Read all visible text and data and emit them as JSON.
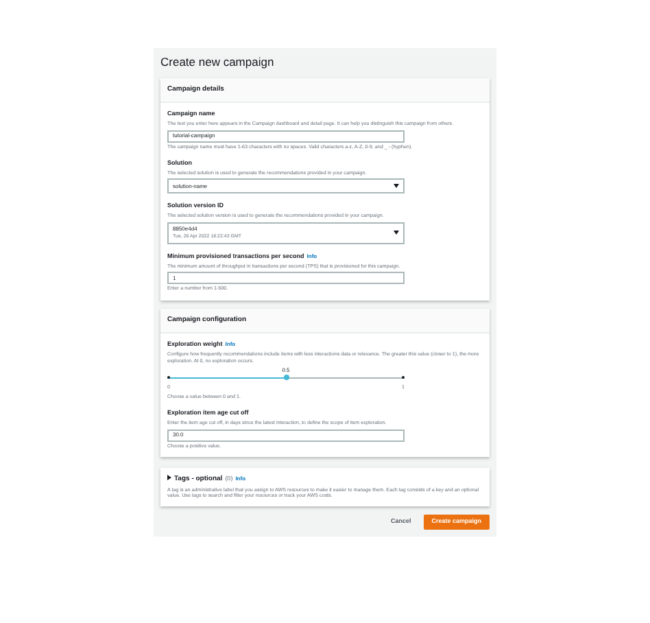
{
  "title": "Create new campaign",
  "details": {
    "heading": "Campaign details",
    "fields": [
      {
        "kind": "input",
        "label": "Campaign name",
        "description": "The text you enter here appears in the Campaign dashboard and detail page. It can help you distinguish this campaign from others.",
        "value": "tutorial-campaign",
        "hint": "The campaign name must have 1-63 characters with no spaces. Valid characters a-z, A-Z, 0-9, and _ - (hyphen)."
      },
      {
        "kind": "select",
        "label": "Solution",
        "description": "The selected solution is used to generate the recommendations provided in your campaign.",
        "value": "solution-name"
      },
      {
        "kind": "select",
        "label": "Solution version ID",
        "description": "The selected solution version is used to generate the recommendations provided in your campaign.",
        "value": "8850e4d4",
        "subvalue": "Tue, 26 Apr 2022 18:22:43 GMT"
      },
      {
        "kind": "input",
        "label": "Minimum provisioned transactions per second",
        "info": "Info",
        "description": "The minimum amount of throughput in transactions per second (TPS) that is provisioned for this campaign.",
        "value": "1",
        "hint": "Enter a number from 1-500."
      }
    ]
  },
  "configuration": {
    "heading": "Campaign configuration",
    "fields": [
      {
        "kind": "slider",
        "label": "Exploration weight",
        "info": "Info",
        "description": "Configure how frequently recommendations include items with less interactions data or relevance. The greater this value (closer to 1), the more exploration. At 0, no exploration occurs.",
        "level": 0.5,
        "reading": "0.5",
        "min": "0",
        "max": "1",
        "hint": "Choose a value between 0 and 1."
      },
      {
        "kind": "input",
        "label": "Exploration item age cut off",
        "description": "Enter the item age cut off, in days since the latest interaction, to define the scope of item exploration.",
        "value": "30.0",
        "hint": "Choose a positive value."
      }
    ]
  },
  "tags": {
    "expanded": false,
    "label": "Tags - optional",
    "count": "(0)",
    "info": "Info",
    "description": "A tag is an administrative label that you assign to AWS resources to make it easier to manage them. Each tag consists of a key and an optional value. Use tags to search and filter your resources or track your AWS costs."
  },
  "buttons": [
    {
      "kind": "link",
      "label": "Cancel"
    },
    {
      "kind": "primary",
      "label": "Create campaign"
    }
  ]
}
